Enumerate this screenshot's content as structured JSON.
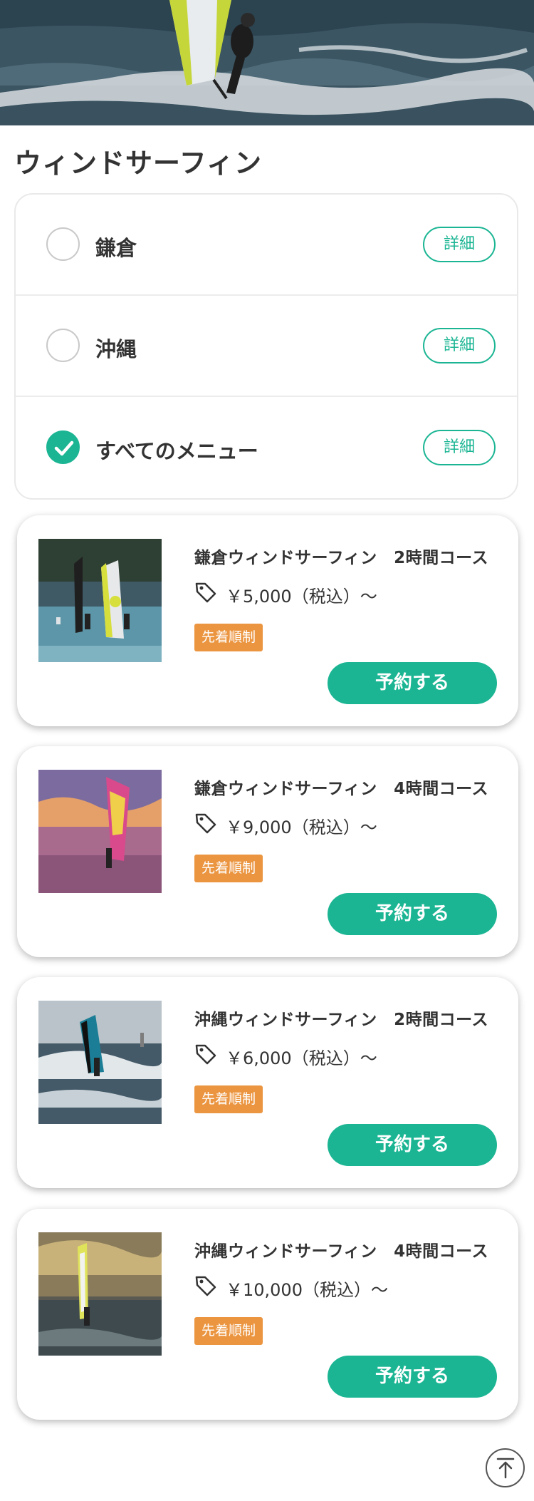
{
  "page": {
    "title": "ウィンドサーフィン"
  },
  "locations": [
    {
      "label": "鎌倉",
      "checked": false,
      "detail_label": "詳細"
    },
    {
      "label": "沖縄",
      "checked": false,
      "detail_label": "詳細"
    },
    {
      "label": "すべてのメニュー",
      "checked": true,
      "detail_label": "詳細"
    }
  ],
  "courses": [
    {
      "title": "鎌倉ウィンドサーフィン　2時間コース",
      "price": "￥5,000（税込）〜",
      "badge": "先着順制",
      "button": "予約する"
    },
    {
      "title": "鎌倉ウィンドサーフィン　4時間コース",
      "price": "￥9,000（税込）〜",
      "badge": "先着順制",
      "button": "予約する"
    },
    {
      "title": "沖縄ウィンドサーフィン　2時間コース",
      "price": "￥6,000（税込）〜",
      "badge": "先着順制",
      "button": "予約する"
    },
    {
      "title": "沖縄ウィンドサーフィン　4時間コース",
      "price": "￥10,000（税込）〜",
      "badge": "先着順制",
      "button": "予約する"
    }
  ],
  "icons": {
    "hero": "windsurfing-photo",
    "price": "price-tag-icon",
    "checked": "checkmark-icon",
    "scroll_top": "arrow-up-icon"
  },
  "colors": {
    "accent": "#1bb593",
    "badge": "#eb9540",
    "text": "#333333"
  }
}
